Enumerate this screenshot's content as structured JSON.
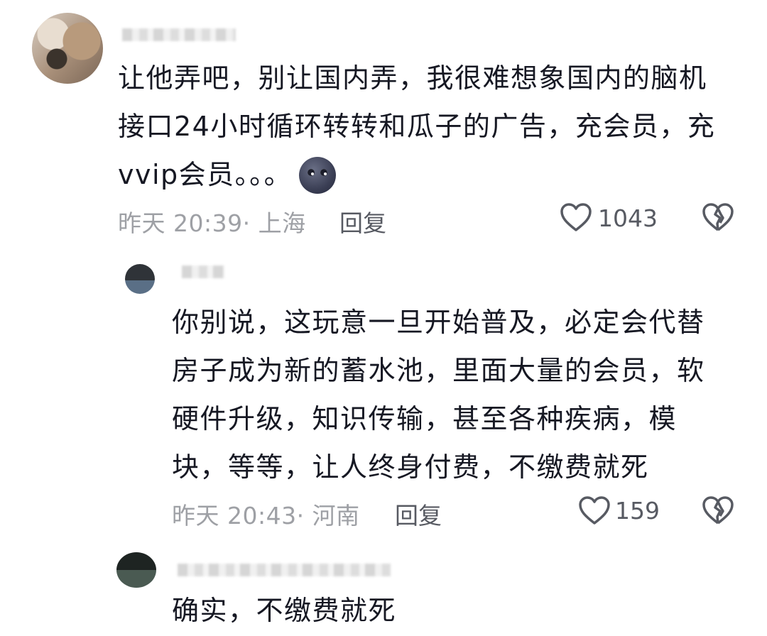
{
  "comments": [
    {
      "text": "让他弄吧，别让国内弄，我很难想象国内的脑机\n接口24小时循环转转和瓜子的广告，充会员，充\nvvip会员。。。",
      "time": "昨天 20:39",
      "location": "· 上海",
      "reply_label": "回复",
      "likes": "1043",
      "emoji": "new-moon-face-emoji"
    },
    {
      "text": "你别说，这玩意一旦开始普及，必定会代替\n房子成为新的蓄水池，里面大量的会员，软\n硬件升级，知识传输，甚至各种疾病，模\n块，等等，让人终身付费，不缴费就死",
      "time": "昨天 20:43",
      "location": "· 河南",
      "reply_label": "回复",
      "likes": "159"
    },
    {
      "text": "确实，不缴费就死"
    }
  ],
  "icons": {
    "like": "heart-outline-icon",
    "dislike": "broken-heart-icon"
  },
  "colors": {
    "text": "#161823",
    "meta": "#9ea0a5",
    "action": "#575a62"
  }
}
